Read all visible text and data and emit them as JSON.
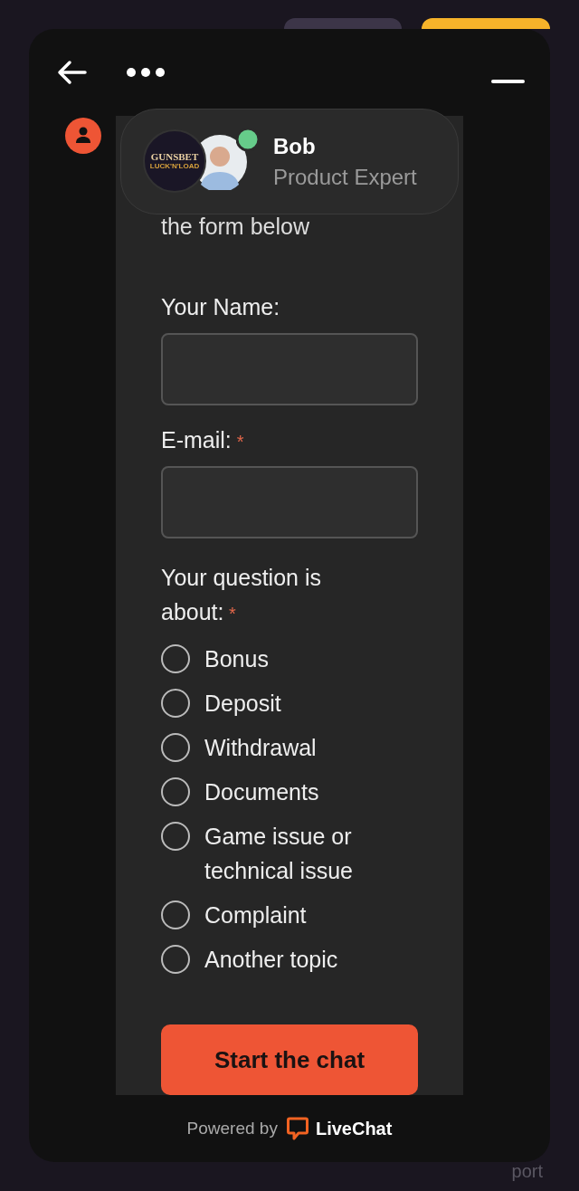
{
  "header": {
    "agent_name": "Bob",
    "agent_role": "Product Expert",
    "online": true,
    "logo_title": "GUNSBET",
    "logo_subtitle": "LUCK'N'LOAD"
  },
  "intro": "the form below",
  "fields": [
    {
      "label": "Your Name:"
    },
    {
      "label": "E-mail:",
      "required_mark": "*"
    }
  ],
  "question": {
    "label": "Your question is about:",
    "required_mark": "*",
    "options": [
      {
        "label": "Bonus",
        "selected": false
      },
      {
        "label": "Deposit",
        "selected": false
      },
      {
        "label": "Withdrawal",
        "selected": false
      },
      {
        "label": "Documents",
        "selected": false
      },
      {
        "label": "Game issue or technical issue",
        "selected": false
      },
      {
        "label": "Complaint",
        "selected": false
      },
      {
        "label": "Another topic",
        "selected": false
      }
    ]
  },
  "submit": "Start the chat",
  "footer": {
    "powered_by": "Powered by",
    "brand": "LiveChat"
  },
  "background_text": "port"
}
